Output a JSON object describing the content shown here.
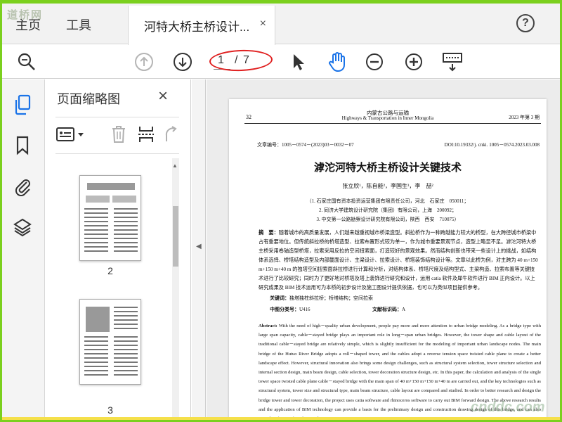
{
  "tabs": {
    "home": "主页",
    "tools": "工具",
    "document": "河特大桥主桥设计...",
    "close": "×",
    "help": "?",
    "watermark_site": "道桥网"
  },
  "toolbar": {
    "page_current": "1",
    "page_separator": "/",
    "page_total": "7",
    "icons": [
      "search-icon",
      "page-up-icon",
      "page-down-icon",
      "select-arrow-icon",
      "hand-icon",
      "zoom-out-icon",
      "zoom-in-icon",
      "keyboard-icon"
    ]
  },
  "sidebar": {
    "icons": [
      "pages-icon",
      "bookmark-icon",
      "attachment-icon",
      "layers-icon"
    ]
  },
  "thumbnails": {
    "title": "页面缩略图",
    "close": "×",
    "pages": [
      {
        "label": "2"
      },
      {
        "label": "3"
      }
    ]
  },
  "document": {
    "page_num": "32",
    "journal_cn": "内蒙古公路与运输",
    "journal_en": "Highways & Transportation in Inner Mongolia",
    "issue": "2023 年第 3 期",
    "article_no": "文章编号：1005－0574－(2023)03－0032－07",
    "doi": "DOI:10.19332/j. cnki. 1005－0574.2023.03.008",
    "title": "滹沱河特大桥主桥设计关键技术",
    "authors": "张立欣¹，陈自能²，李国生³，李　喆²",
    "affiliations": [
      "（1. 石家庄国有资本投资运营集团有限责任公司，河北　石家庄　050011；",
      "2. 同济大学建筑设计研究院（集团）有限公司，上海　200092；",
      "3. 中交第一公路勘察设计研究院有限公司，陕西　西安　710075）"
    ],
    "abstract_cn_label": "摘　要：",
    "abstract_cn": "随着城市的高质量发展，人们越来越重视城市桥梁造型。斜拉桥作为一种跨越能力较大的桥型，在大跨径城市桥梁中占有重要地位。但传统斜拉桥的桥塔造型、拉索布置形式较为单一，作为城市重要景观节点，造型上略显不足。滹沱河特大桥主桥采用卷轴造型桥塔，拉索采用反拉的空间扭索面，打造较好的景观效果。然而结构创新也带来一些设计上的挑战，如结构体系选择、桥塔结构造型及内部截面设计、主梁设计、拉索设计、桥塔装饰结构设计等。文章以此桥为例，对主跨为 40 m+150 m+150 m+40 m 的独塔空间扭索面斜拉桥进行计算和分析，对结构体系、桥塔尺度及结构型式、主梁构造、拉索布置等关键技术进行了比较研究；同时为了更好地对桥塔及塔上装饰进行研究和设计，运用 catia 软件及犀牛软件进行 BIM 正向设计。以上研究成果及 BIM 技术运用可为本桥的初步设计及施工图设计提供依据，也可以为类似项目提供参考。",
    "keywords_label": "关键词：",
    "keywords": "独塔独柱斜拉桥；桥塔结构；空间拉索",
    "class_label": "中图分类号：",
    "class_value": "U416",
    "doc_id_label": "文献标识码：",
    "doc_id_value": "A",
    "abstract_en_label": "Abstract:",
    "abstract_en": "With the need of high－quality urban development, people pay more and more attention to urban bridge modeling. As a bridge type with large span capacity, cable－stayed bridge plays an important role in long－span urban bridges. However, the tower shape and cable layout of the traditional cable－stayed bridge are relatively simple, which is slightly insufficient for the modeling of important urban landscape nodes. The main bridge of the Hutuo River Bridge adopts a roll－shaped tower, and the cables adopt a reverse tension space twisted cable plane to create a better landscape effect. However, structural innovation also brings some design challenges, such as structural system selection, tower structure selection and internal section design, main beam design, cable selection, tower decoration structure design, etc. In this paper, the calculation and analysis of the single tower space twisted cable plane cable－stayed bridge with the main span of 40 m+150 m+150 m+40 m are carried out, and the key technologies such as structural system, tower size and structural type, main beam structure, cable layout are compared and studied. In order to better research and design the bridge tower and tower decoration, the project uses catia software and rhinoceros software to carry out BIM forward design. The above research results and the application of BIM technology can provide a basis for the preliminary design and construction drawing design of this bridge, and can also provide reference for other similar projects."
  },
  "watermark_br": "cnddc.com",
  "colors": {
    "frame_green": "#7bd01e",
    "annotation_red": "#e02020",
    "hand_blue": "#1a73e8"
  }
}
